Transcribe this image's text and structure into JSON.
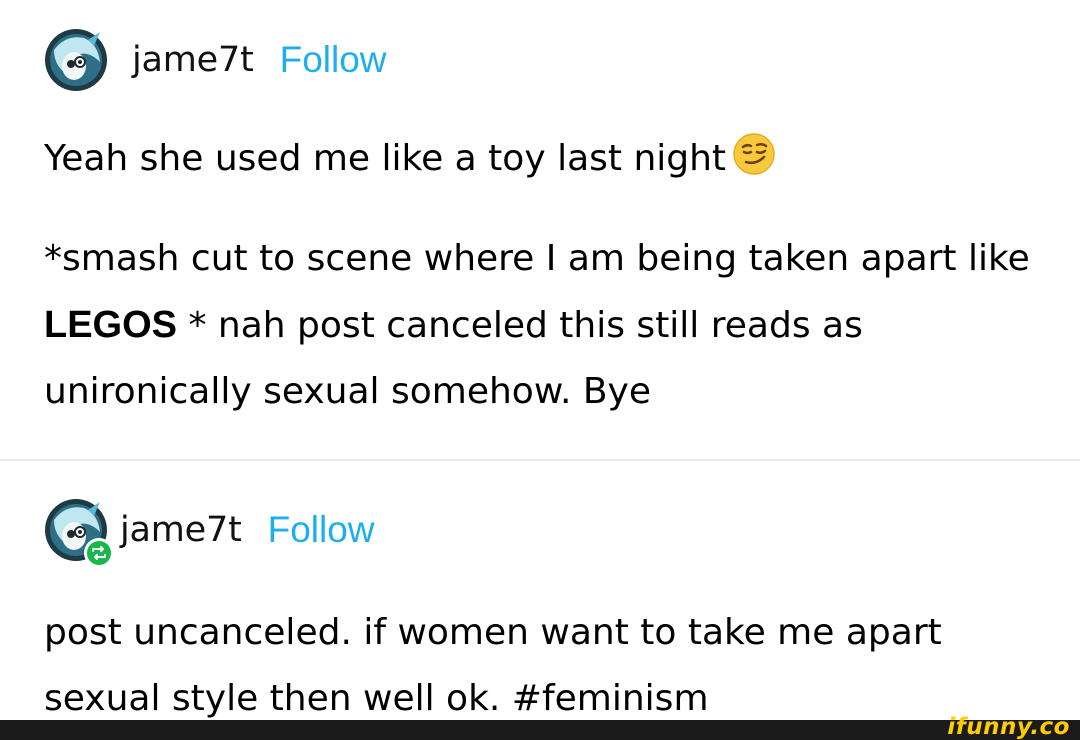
{
  "posts": [
    {
      "username": "jame7t",
      "follow_label": "Follow",
      "paragraphs": {
        "first": "Yeah she used me like a toy last night",
        "second_pre": "*smash cut to scene where I am being taken apart like ",
        "second_bold": "LEGOS",
        "second_post": " * nah post canceled this still reads as unironically sexual somehow. Bye"
      },
      "emoji": "smirking-face-emoji"
    },
    {
      "username": "jame7t",
      "follow_label": "Follow",
      "reblog_icon": "reblog-icon",
      "paragraphs": {
        "first": "post uncanceled.  if women want to take me apart sexual style then well ok. #feminism"
      }
    }
  ],
  "watermark": "ifunny.co",
  "colors": {
    "follow": "#1eaef0",
    "reblog_badge": "#19b84a",
    "watermark": "#ffcc00",
    "footer": "#1b1b1b"
  }
}
